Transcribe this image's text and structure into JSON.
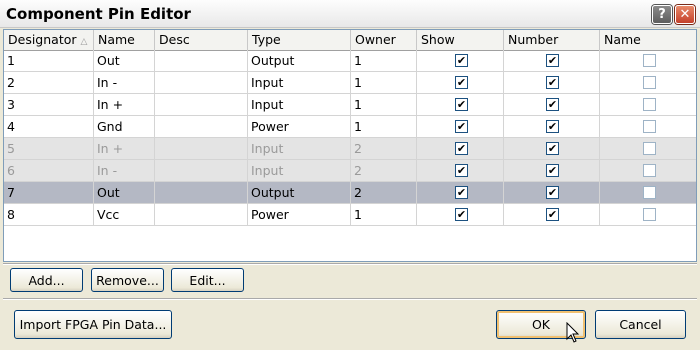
{
  "window": {
    "title": "Component Pin Editor",
    "help_glyph": "?",
    "close_glyph": "✕"
  },
  "table": {
    "columns": [
      "Designator",
      "Name",
      "Desc",
      "Type",
      "Owner",
      "Show",
      "Number",
      "Name"
    ],
    "sort_indicator": "△",
    "rows": [
      {
        "designator": "1",
        "name": "Out",
        "desc": "",
        "type": "Output",
        "owner": "1",
        "show": true,
        "number": true,
        "name_visible": false,
        "state": "normal"
      },
      {
        "designator": "2",
        "name": "In -",
        "desc": "",
        "type": "Input",
        "owner": "1",
        "show": true,
        "number": true,
        "name_visible": false,
        "state": "normal"
      },
      {
        "designator": "3",
        "name": "In +",
        "desc": "",
        "type": "Input",
        "owner": "1",
        "show": true,
        "number": true,
        "name_visible": false,
        "state": "normal"
      },
      {
        "designator": "4",
        "name": "Gnd",
        "desc": "",
        "type": "Power",
        "owner": "1",
        "show": true,
        "number": true,
        "name_visible": false,
        "state": "normal"
      },
      {
        "designator": "5",
        "name": "In +",
        "desc": "",
        "type": "Input",
        "owner": "2",
        "show": true,
        "number": true,
        "name_visible": false,
        "state": "grey"
      },
      {
        "designator": "6",
        "name": "In -",
        "desc": "",
        "type": "Input",
        "owner": "2",
        "show": true,
        "number": true,
        "name_visible": false,
        "state": "grey"
      },
      {
        "designator": "7",
        "name": "Out",
        "desc": "",
        "type": "Output",
        "owner": "2",
        "show": true,
        "number": true,
        "name_visible": false,
        "state": "selected"
      },
      {
        "designator": "8",
        "name": "Vcc",
        "desc": "",
        "type": "Power",
        "owner": "1",
        "show": true,
        "number": true,
        "name_visible": false,
        "state": "normal"
      }
    ]
  },
  "buttons": {
    "add": "Add...",
    "remove": "Remove...",
    "edit": "Edit...",
    "import": "Import FPGA Pin Data...",
    "ok": "OK",
    "cancel": "Cancel"
  },
  "colors": {
    "selected_row": "#b4b8c4",
    "grey_row": "#e4e4e4",
    "grey_text": "#9a9a9a"
  }
}
